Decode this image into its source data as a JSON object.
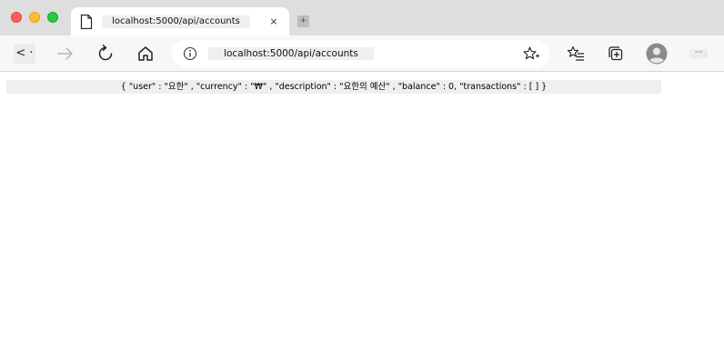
{
  "tab": {
    "title": "localhost:5000/api/accounts",
    "close_glyph": "×",
    "new_tab_glyph": "+"
  },
  "toolbar": {
    "back_glyph": "< ·",
    "url": "localhost:5000/api/accounts",
    "more_glyph": "···"
  },
  "page": {
    "json_text": "{ \"user\" : \"요한\" , \"currency\" : \"₩\" , \"description\" : \"요한의 예산\" , \"balance\" : 0, \"transactions\" : [ ] }"
  },
  "icons": {
    "page": "page-icon",
    "back": "back-arrow-icon",
    "forward": "forward-arrow-icon",
    "reload": "reload-icon",
    "home": "home-icon",
    "info": "info-icon",
    "favorite": "star-icon",
    "favorites": "favorites-list-icon",
    "collections": "collections-icon",
    "profile": "profile-avatar-icon"
  },
  "colors": {
    "tabstrip": "#dedede",
    "toolbar": "#f7f7f7",
    "close": "#fe5f57",
    "minimize": "#febc2e",
    "maximize": "#28c840"
  }
}
